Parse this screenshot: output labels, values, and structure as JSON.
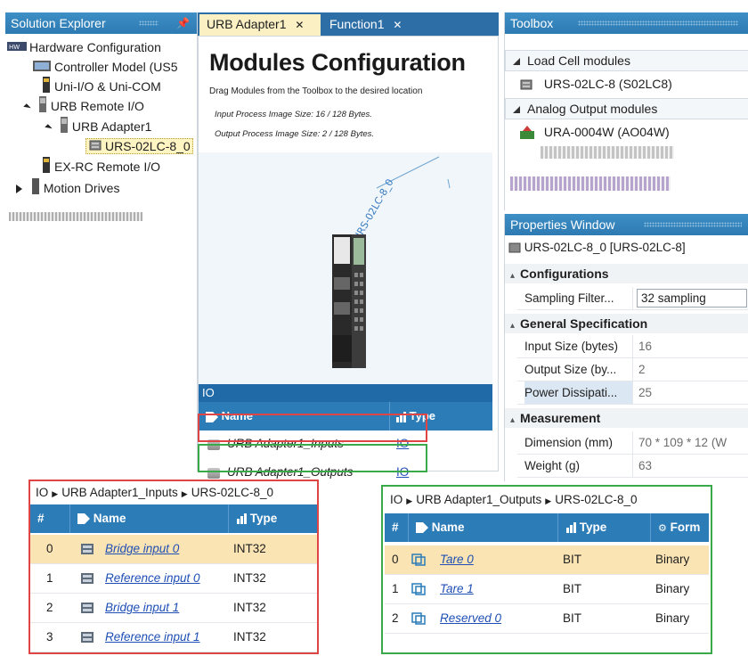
{
  "solution_explorer": {
    "title": "Solution Explorer",
    "pin": "📌",
    "items": [
      {
        "label": "Hardware Configuration"
      },
      {
        "label": "Controller Model (US5"
      },
      {
        "label": "Uni-I/O & Uni-COM"
      },
      {
        "label": "URB Remote I/O"
      },
      {
        "label": "URB Adapter1"
      },
      {
        "label": "URS-02LC-8_0"
      },
      {
        "label": "EX-RC Remote I/O"
      },
      {
        "label": "Motion Drives"
      }
    ]
  },
  "document": {
    "tabs": [
      {
        "label": "URB Adapter1",
        "close": "✕"
      },
      {
        "label": "Function1",
        "close": "✕"
      }
    ],
    "title": "Modules Configuration",
    "subtitle": "Drag Modules from the Toolbox to the desired location",
    "input_size": "Input Process Image Size: 16 / 128 Bytes.",
    "output_size": "Output Process Image Size: 2 / 128 Bytes.",
    "module_label": "URS-02LC-8_0",
    "io": {
      "header": "IO",
      "col_name": "Name",
      "col_type": "Type",
      "rows": [
        {
          "name": "URB Adapter1_Inputs",
          "type": "IO"
        },
        {
          "name": "URB Adapter1_Outputs",
          "type": "IO"
        }
      ]
    }
  },
  "toolbox": {
    "title": "Toolbox",
    "groups": [
      {
        "label": "Load Cell modules",
        "items": [
          "URS-02LC-8 (S02LC8)"
        ]
      },
      {
        "label": "Analog Output modules",
        "items": [
          "URA-0004W (AO04W)"
        ]
      }
    ]
  },
  "properties": {
    "title": "Properties Window",
    "object": "URS-02LC-8_0 [URS-02LC-8]",
    "categories": [
      {
        "label": "Configurations"
      },
      {
        "label": "General Specification"
      },
      {
        "label": "Measurement"
      }
    ],
    "rows": {
      "sampling_filter": {
        "key": "Sampling Filter...",
        "value": "32 sampling"
      },
      "input_size": {
        "key": "Input Size (bytes)",
        "value": "16"
      },
      "output_size": {
        "key": "Output Size (by...",
        "value": "2"
      },
      "power": {
        "key": "Power Dissipati...",
        "value": "25"
      },
      "dimension": {
        "key": "Dimension (mm)",
        "value": "70 * 109 * 12 (W"
      },
      "weight": {
        "key": "Weight (g)",
        "value": "63"
      }
    }
  },
  "inputs_table": {
    "breadcrumb": [
      "IO",
      "URB Adapter1_Inputs",
      "URS-02LC-8_0"
    ],
    "sep": "▶",
    "cols": [
      "#",
      "Name",
      "Type"
    ],
    "rows": [
      {
        "idx": "0",
        "name": "Bridge input 0",
        "type": "INT32"
      },
      {
        "idx": "1",
        "name": "Reference input 0",
        "type": "INT32"
      },
      {
        "idx": "2",
        "name": "Bridge input 1",
        "type": "INT32"
      },
      {
        "idx": "3",
        "name": "Reference input 1",
        "type": "INT32"
      }
    ]
  },
  "outputs_table": {
    "breadcrumb": [
      "IO",
      "URB Adapter1_Outputs",
      "URS-02LC-8_0"
    ],
    "sep": "▶",
    "cols": [
      "#",
      "Name",
      "Type",
      "Form"
    ],
    "rows": [
      {
        "idx": "0",
        "name": "Tare 0",
        "type": "BIT",
        "form": "Binary"
      },
      {
        "idx": "1",
        "name": "Tare 1",
        "type": "BIT",
        "form": "Binary"
      },
      {
        "idx": "2",
        "name": "Reserved 0",
        "type": "BIT",
        "form": "Binary"
      }
    ]
  },
  "colors": {
    "accent": "#2c7cb8",
    "header_dark": "#1f6aa7",
    "highlight_box_red": "#e04545",
    "highlight_box_green": "#3aa94a",
    "selected_row": "#fbe4b4",
    "active_tab": "#fbf0c4"
  }
}
